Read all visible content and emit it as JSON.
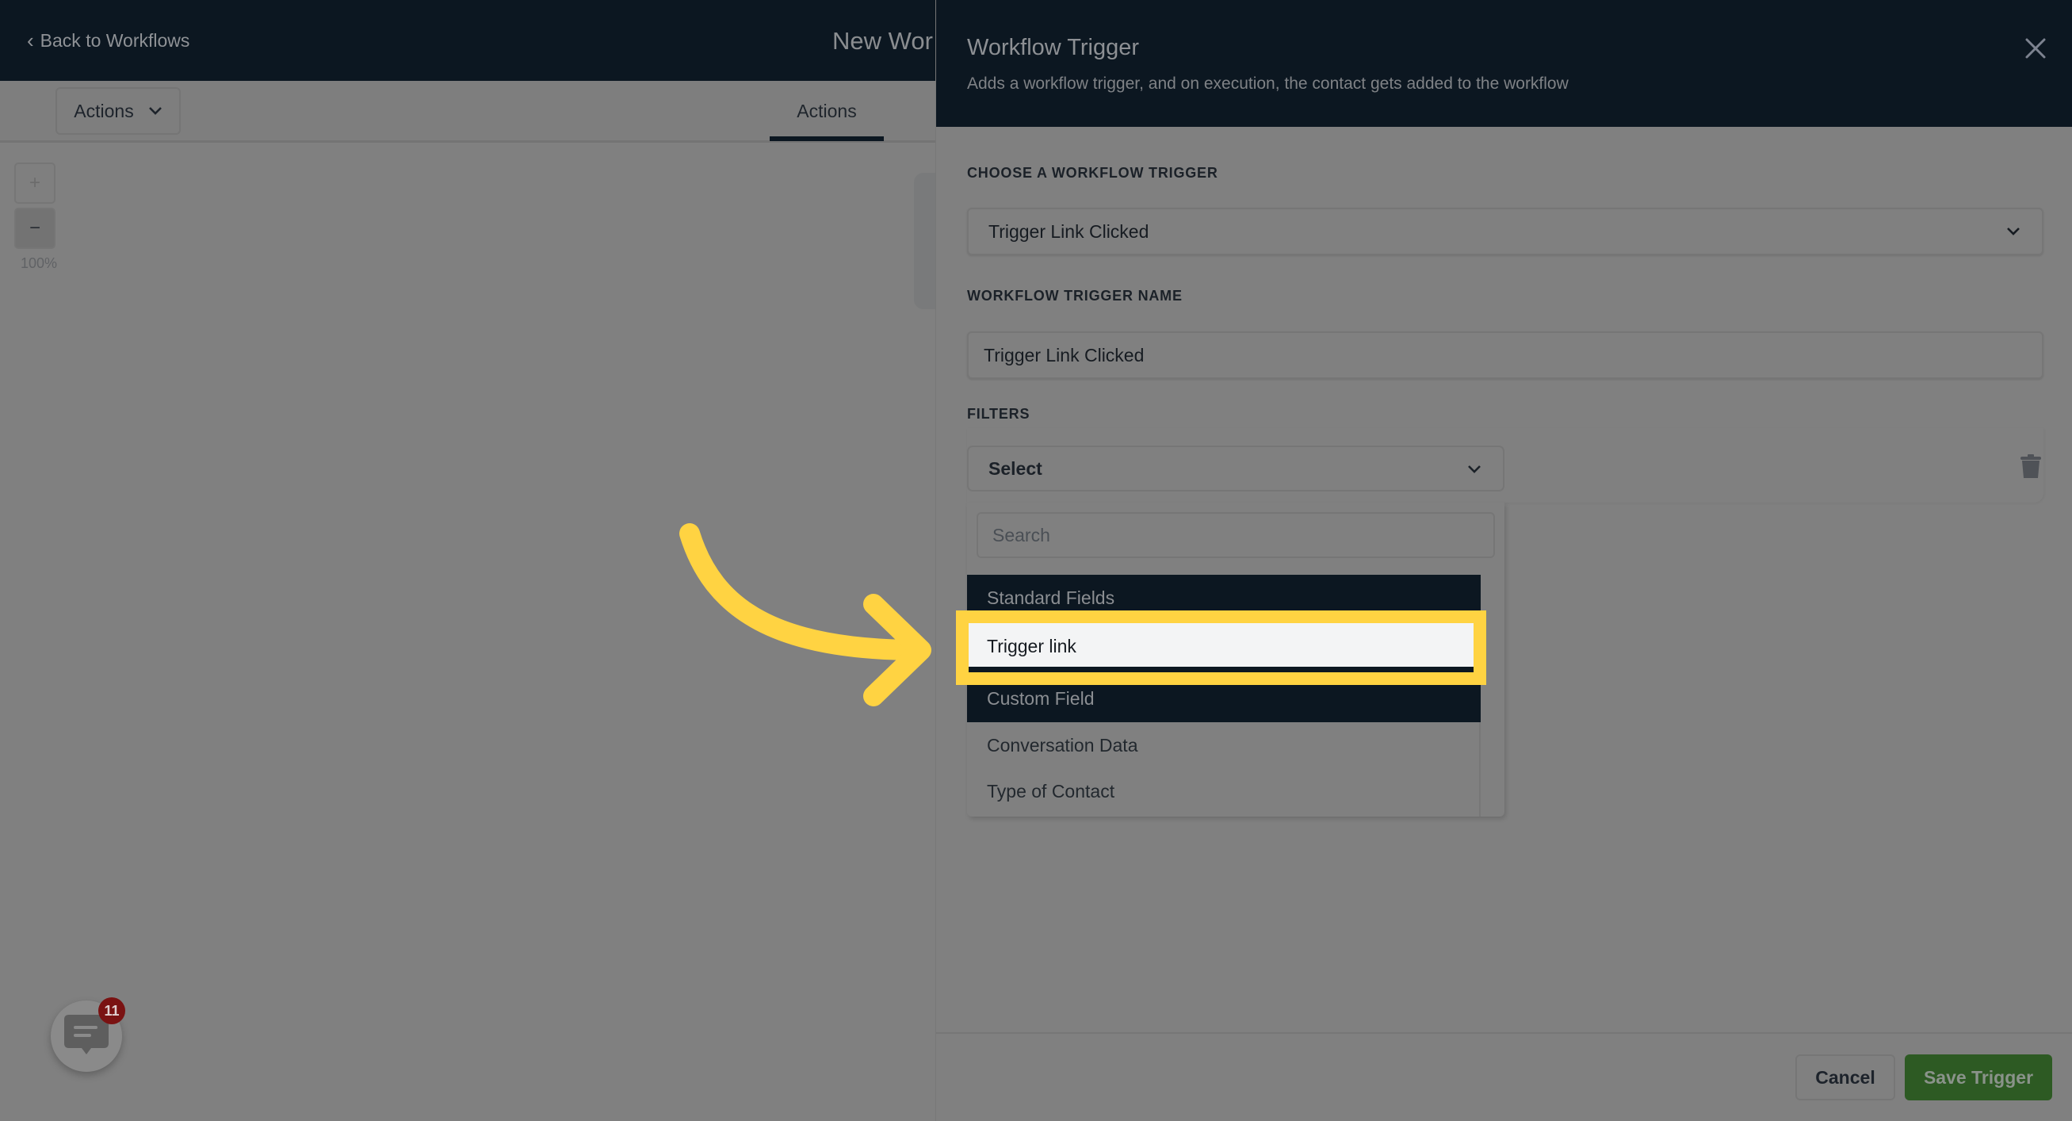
{
  "topbar": {
    "back_label": "Back to Workflows",
    "workflow_title": "New Wor"
  },
  "subbar": {
    "actions_dropdown_label": "Actions",
    "tab_label": "Actions"
  },
  "canvas": {
    "zoom_in": "+",
    "zoom_out": "−",
    "zoom_level": "100%"
  },
  "chat": {
    "badge_count": "11"
  },
  "panel": {
    "title": "Workflow Trigger",
    "subtitle": "Adds a workflow trigger, and on execution, the contact gets added to the workflow",
    "choose_label": "CHOOSE A WORKFLOW TRIGGER",
    "choose_value": "Trigger Link Clicked",
    "name_label": "WORKFLOW TRIGGER NAME",
    "name_value": "Trigger Link Clicked",
    "filters_label": "FILTERS",
    "filter_select_value": "Select",
    "search_placeholder": "Search",
    "dropdown_items": [
      {
        "label": "Standard Fields",
        "style": "group"
      },
      {
        "label": "Trigger link",
        "style": "active"
      },
      {
        "label": "Custom Field",
        "style": "group"
      },
      {
        "label": "Conversation Data",
        "style": "normal"
      },
      {
        "label": "Type of Contact",
        "style": "normal"
      }
    ],
    "cancel_label": "Cancel",
    "save_label": "Save Trigger"
  },
  "colors": {
    "header_bg": "#0c1721",
    "save_green": "#2d5a23",
    "highlight_yellow": "#ffd342",
    "badge_red": "#7a1212"
  }
}
